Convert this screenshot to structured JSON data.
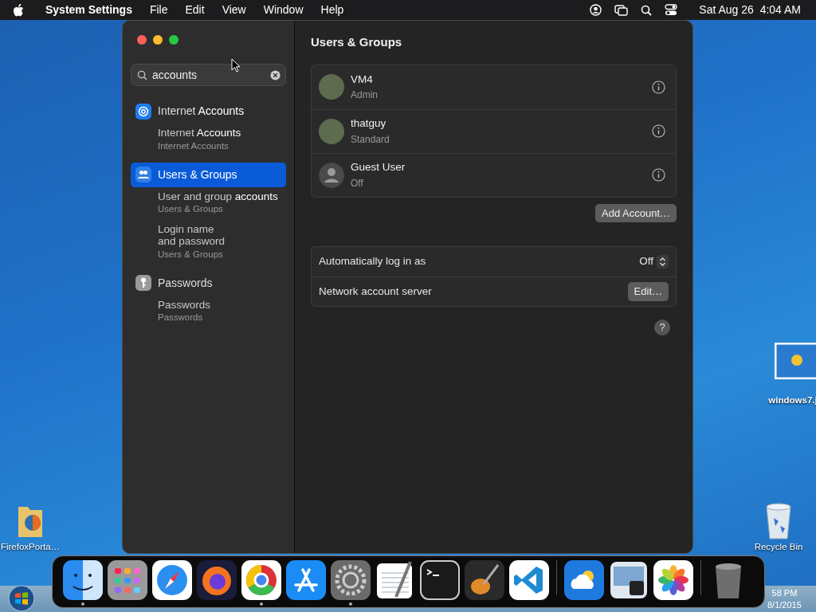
{
  "menubar": {
    "app": "System Settings",
    "menus": [
      "File",
      "Edit",
      "View",
      "Window",
      "Help"
    ],
    "clock": "Sat Aug 26  4:04 AM"
  },
  "window": {
    "search": {
      "value": "accounts"
    },
    "results": [
      {
        "kind": "at",
        "title": "Internet **Accounts**",
        "selected": false,
        "children": [
          {
            "title": "Internet **Accounts**",
            "subtitle": "Internet Accounts"
          }
        ]
      },
      {
        "kind": "users",
        "title": "Users & Groups",
        "selected": true,
        "children": [
          {
            "title": "User and group **accounts**",
            "subtitle": "Users & Groups"
          },
          {
            "title": "Login name\nand password",
            "subtitle": "Users & Groups"
          }
        ]
      },
      {
        "kind": "key",
        "title": "Passwords",
        "selected": false,
        "children": [
          {
            "title": "Passwords",
            "subtitle": "Passwords"
          }
        ]
      }
    ],
    "pane": {
      "title": "Users & Groups",
      "users": [
        {
          "name": "VM4",
          "role": "Admin",
          "kind": "photo"
        },
        {
          "name": "thatguy",
          "role": "Standard",
          "kind": "photo"
        },
        {
          "name": "Guest User",
          "role": "Off",
          "kind": "guest"
        }
      ],
      "add_button": "Add Account…",
      "settings": [
        {
          "label": "Automatically log in as",
          "kind": "popup",
          "value": "Off"
        },
        {
          "label": "Network account server",
          "kind": "button",
          "value": "Edit…"
        }
      ],
      "help_button": "?"
    }
  },
  "desktop_icons": [
    {
      "kind": "image",
      "label": "windows7.j"
    },
    {
      "kind": "trash",
      "label": "Recycle Bin"
    },
    {
      "kind": "folder",
      "label": "FirefoxPorta…"
    }
  ],
  "taskbar": {
    "time": "58 PM",
    "date": "8/1/2015"
  },
  "dock": {
    "sections": [
      [
        {
          "running": true
        },
        {
          "running": false
        },
        {
          "running": false
        },
        {
          "running": false
        },
        {
          "running": true
        },
        {
          "running": false
        },
        {
          "running": true
        },
        {
          "running": false
        },
        {
          "running": false
        },
        {
          "running": false
        },
        {
          "running": false
        }
      ],
      [
        {
          "running": false
        },
        {
          "running": false
        },
        {
          "running": false
        }
      ],
      [
        {
          "running": false
        }
      ]
    ]
  }
}
